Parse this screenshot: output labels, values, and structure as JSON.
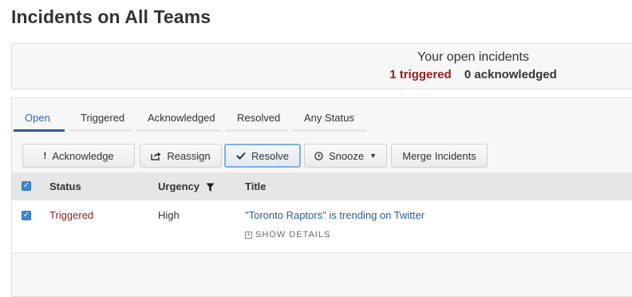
{
  "page": {
    "title": "Incidents on All Teams"
  },
  "summary": {
    "heading": "Your open incidents",
    "triggered": "1 triggered",
    "acknowledged": "0 acknowledged"
  },
  "tabs": [
    {
      "label": "Open",
      "active": true
    },
    {
      "label": "Triggered",
      "active": false
    },
    {
      "label": "Acknowledged",
      "active": false
    },
    {
      "label": "Resolved",
      "active": false
    },
    {
      "label": "Any Status",
      "active": false
    }
  ],
  "toolbar": {
    "acknowledge": {
      "label": "Acknowledge",
      "icon": "exclamation-icon"
    },
    "reassign": {
      "label": "Reassign",
      "icon": "share-icon"
    },
    "resolve": {
      "label": "Resolve",
      "icon": "checkmark-icon"
    },
    "snooze": {
      "label": "Snooze",
      "icon": "clock-icon",
      "caret": "chevron-down-icon"
    },
    "merge": {
      "label": "Merge Incidents"
    }
  },
  "table": {
    "columns": {
      "status": "Status",
      "urgency": "Urgency",
      "title": "Title"
    },
    "rows": [
      {
        "checked": true,
        "status": "Triggered",
        "urgency": "High",
        "title": "\"Toronto Raptors\" is trending on Twitter",
        "show_details": "SHOW DETAILS"
      }
    ]
  },
  "colors": {
    "accent": "#2b5b9a",
    "triggered": "#961b1b",
    "checkbox": "#3b86d8"
  }
}
